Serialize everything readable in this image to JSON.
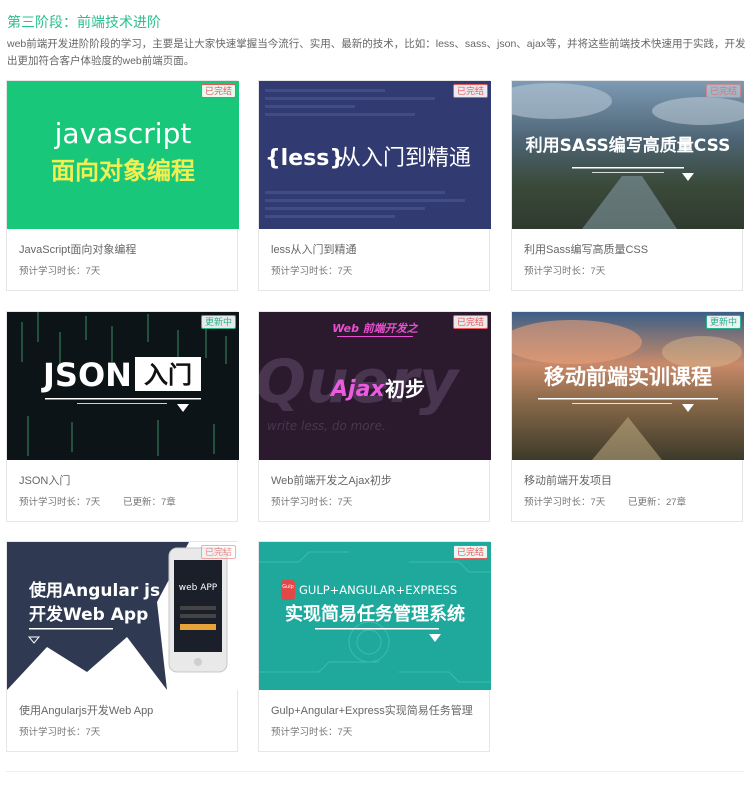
{
  "stage": {
    "title": "第三阶段：前端技术进阶",
    "description": "web前端开发进阶阶段的学习，主要是让大家快速掌握当今流行、实用、最新的技术，比如：less、sass、json、ajax等，并将这些前端技术快速用于实践，开发出更加符合客户体验度的web前端页面。"
  },
  "labels": {
    "duration_prefix": "预计学习时长：",
    "updated_prefix": "已更新："
  },
  "colors": {
    "accent": "#2bbf8c",
    "done_badge": "#e85a5a",
    "updating_badge": "#2bb08c"
  },
  "courses": [
    {
      "title": "JavaScript面向对象编程",
      "duration": "预计学习时长：7天",
      "badge": "已完结",
      "thumb": {
        "line1": "javascript",
        "line2": "面向对象编程"
      }
    },
    {
      "title": "less从入门到精通",
      "duration": "预计学习时长：7天",
      "badge": "已完结",
      "thumb": {
        "brand": "{less}",
        "line1": "从入门到精通"
      }
    },
    {
      "title": "利用Sass编写高质量CSS",
      "duration": "预计学习时长：7天",
      "badge": "已完结",
      "thumb": {
        "line1": "利用SASS编写高质量CSS"
      }
    },
    {
      "title": "JSON入门",
      "duration": "预计学习时长：7天",
      "updated": "已更新：7章",
      "badge": "更新中",
      "thumb": {
        "line1": "JSON",
        "line2": "入门"
      }
    },
    {
      "title": "Web前端开发之Ajax初步",
      "duration": "预计学习时长：7天",
      "badge": "已完结",
      "thumb": {
        "top": "Web 前端开发之",
        "bg_word": "Query",
        "bg_sub": "write less, do more.",
        "line1": "Ajax",
        "line2": "初步"
      }
    },
    {
      "title": "移动前端开发项目",
      "duration": "预计学习时长：7天",
      "updated": "已更新：27章",
      "badge": "更新中",
      "thumb": {
        "line1": "移动前端实训课程"
      }
    },
    {
      "title": "使用Angularjs开发Web App",
      "duration": "预计学习时长：7天",
      "badge": "已完结",
      "thumb": {
        "line1": "使用Angular js",
        "line2": "开发Web App",
        "phone": "web APP"
      }
    },
    {
      "title": "Gulp+Angular+Express实现简易任务管理",
      "duration": "预计学习时长：7天",
      "badge": "已完结",
      "thumb": {
        "logo": "Gulp",
        "line1": "GULP+ANGULAR+EXPRESS",
        "line2": "实现简易任务管理系统"
      }
    }
  ]
}
